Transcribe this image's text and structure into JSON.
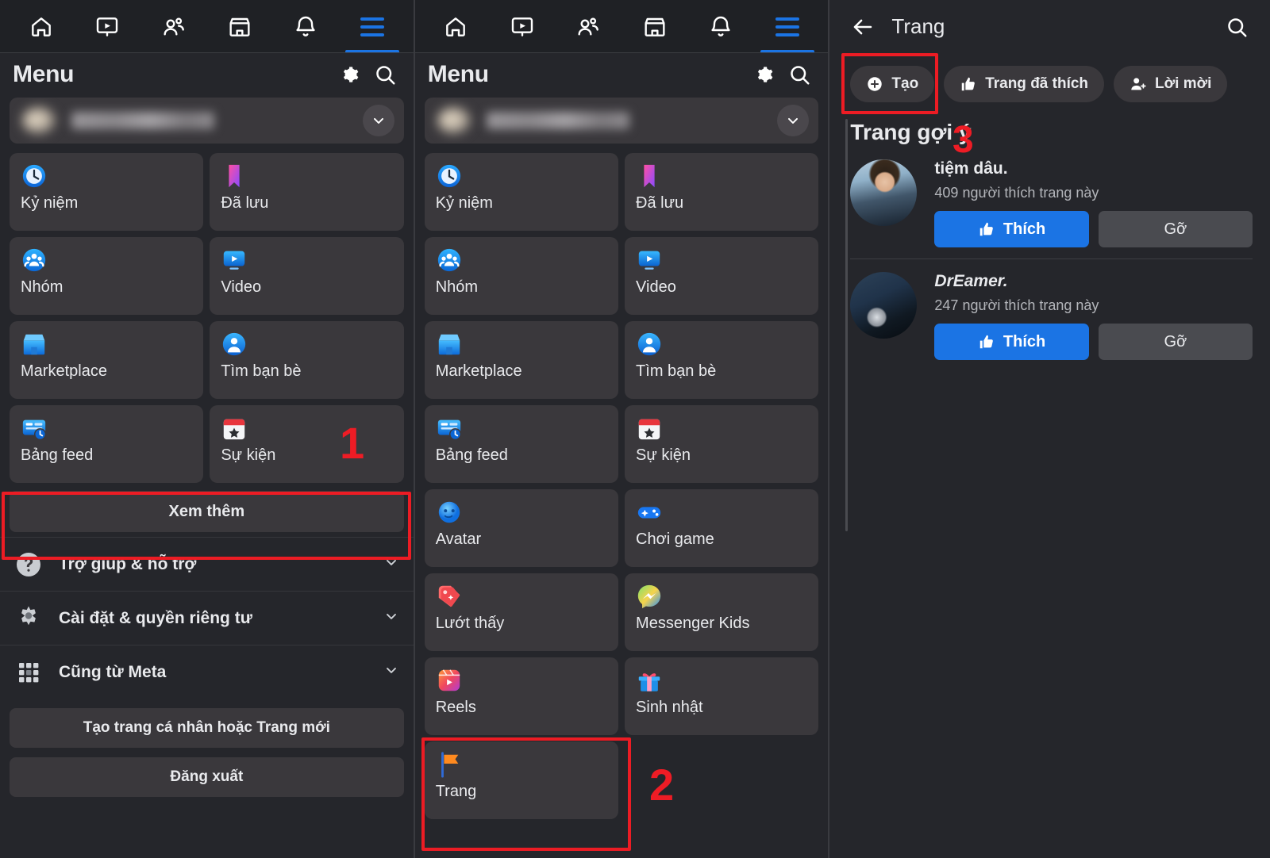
{
  "topnav": {
    "items": [
      {
        "name": "home-icon",
        "label": "Trang chủ",
        "active": false
      },
      {
        "name": "video-icon",
        "label": "Video",
        "active": false
      },
      {
        "name": "friends-icon",
        "label": "Bạn bè",
        "active": false
      },
      {
        "name": "marketplace-icon",
        "label": "Marketplace",
        "active": false
      },
      {
        "name": "bell-icon",
        "label": "Thông báo",
        "active": false
      },
      {
        "name": "hamburger-icon",
        "label": "Menu",
        "active": true
      }
    ]
  },
  "menu_header": {
    "title": "Menu",
    "settings_icon": "gear-icon",
    "search_icon": "search-icon",
    "profile_caret_icon": "chevron-down-icon"
  },
  "left_panel": {
    "tiles": [
      {
        "label": "Kỷ niệm",
        "icon": "clock-icon"
      },
      {
        "label": "Đã lưu",
        "icon": "bookmark-icon"
      },
      {
        "label": "Nhóm",
        "icon": "groups-icon"
      },
      {
        "label": "Video",
        "icon": "video-icon"
      },
      {
        "label": "Marketplace",
        "icon": "shop-icon"
      },
      {
        "label": "Tìm bạn bè",
        "icon": "find-friends-icon"
      },
      {
        "label": "Bảng feed",
        "icon": "feed-icon"
      },
      {
        "label": "Sự kiện",
        "icon": "calendar-star-icon"
      }
    ],
    "see_more_label": "Xem thêm",
    "rows": [
      {
        "label": "Trợ giúp & hỗ trợ",
        "icon": "question-circle-icon",
        "caret": "chevron-down-icon"
      },
      {
        "label": "Cài đặt & quyền riêng tư",
        "icon": "gear-icon",
        "caret": "chevron-down-icon"
      },
      {
        "label": "Cũng từ Meta",
        "icon": "grid-dots-icon",
        "caret": "chevron-down-icon"
      }
    ],
    "create_label": "Tạo trang cá nhân hoặc Trang mới",
    "logout_label": "Đăng xuất"
  },
  "mid_panel": {
    "tiles": [
      {
        "label": "Kỷ niệm",
        "icon": "clock-icon"
      },
      {
        "label": "Đã lưu",
        "icon": "bookmark-icon"
      },
      {
        "label": "Nhóm",
        "icon": "groups-icon"
      },
      {
        "label": "Video",
        "icon": "video-icon"
      },
      {
        "label": "Marketplace",
        "icon": "shop-icon"
      },
      {
        "label": "Tìm bạn bè",
        "icon": "find-friends-icon"
      },
      {
        "label": "Bảng feed",
        "icon": "feed-icon"
      },
      {
        "label": "Sự kiện",
        "icon": "calendar-star-icon"
      },
      {
        "label": "Avatar",
        "icon": "avatar-icon"
      },
      {
        "label": "Chơi game",
        "icon": "gamepad-icon"
      },
      {
        "label": "Lướt thấy",
        "icon": "tag-icon"
      },
      {
        "label": "Messenger Kids",
        "icon": "messenger-icon"
      },
      {
        "label": "Reels",
        "icon": "reels-icon"
      },
      {
        "label": "Sinh nhật",
        "icon": "gift-icon"
      },
      {
        "label": "Trang",
        "icon": "flag-icon"
      }
    ]
  },
  "right_panel": {
    "back_icon": "arrow-left-icon",
    "title": "Trang",
    "search_icon": "search-icon",
    "pills": [
      {
        "label": "Tạo",
        "icon": "plus-circle-icon"
      },
      {
        "label": "Trang đã thích",
        "icon": "thumbs-up-icon"
      },
      {
        "label": "Lời mời",
        "icon": "person-add-icon"
      }
    ],
    "section_title": "Trang gợi ý",
    "pages": [
      {
        "name": "tiệm dâu.",
        "italic": false,
        "likes": "409 người thích trang này",
        "like_label": "Thích",
        "like_icon": "thumbs-up-icon",
        "remove_label": "Gỡ"
      },
      {
        "name": "DrEamer.",
        "italic": true,
        "likes": "247 người thích trang này",
        "like_label": "Thích",
        "like_icon": "thumbs-up-icon",
        "remove_label": "Gỡ"
      }
    ]
  },
  "annotations": [
    {
      "number": "1"
    },
    {
      "number": "2"
    },
    {
      "number": "3"
    }
  ],
  "colors": {
    "accent_blue": "#1b74e4",
    "annotation_red": "#ee1c25",
    "page_bg": "#25262b",
    "card_bg": "#3a383c",
    "text_primary": "#e9eaed",
    "text_secondary": "#b4b6bb"
  }
}
